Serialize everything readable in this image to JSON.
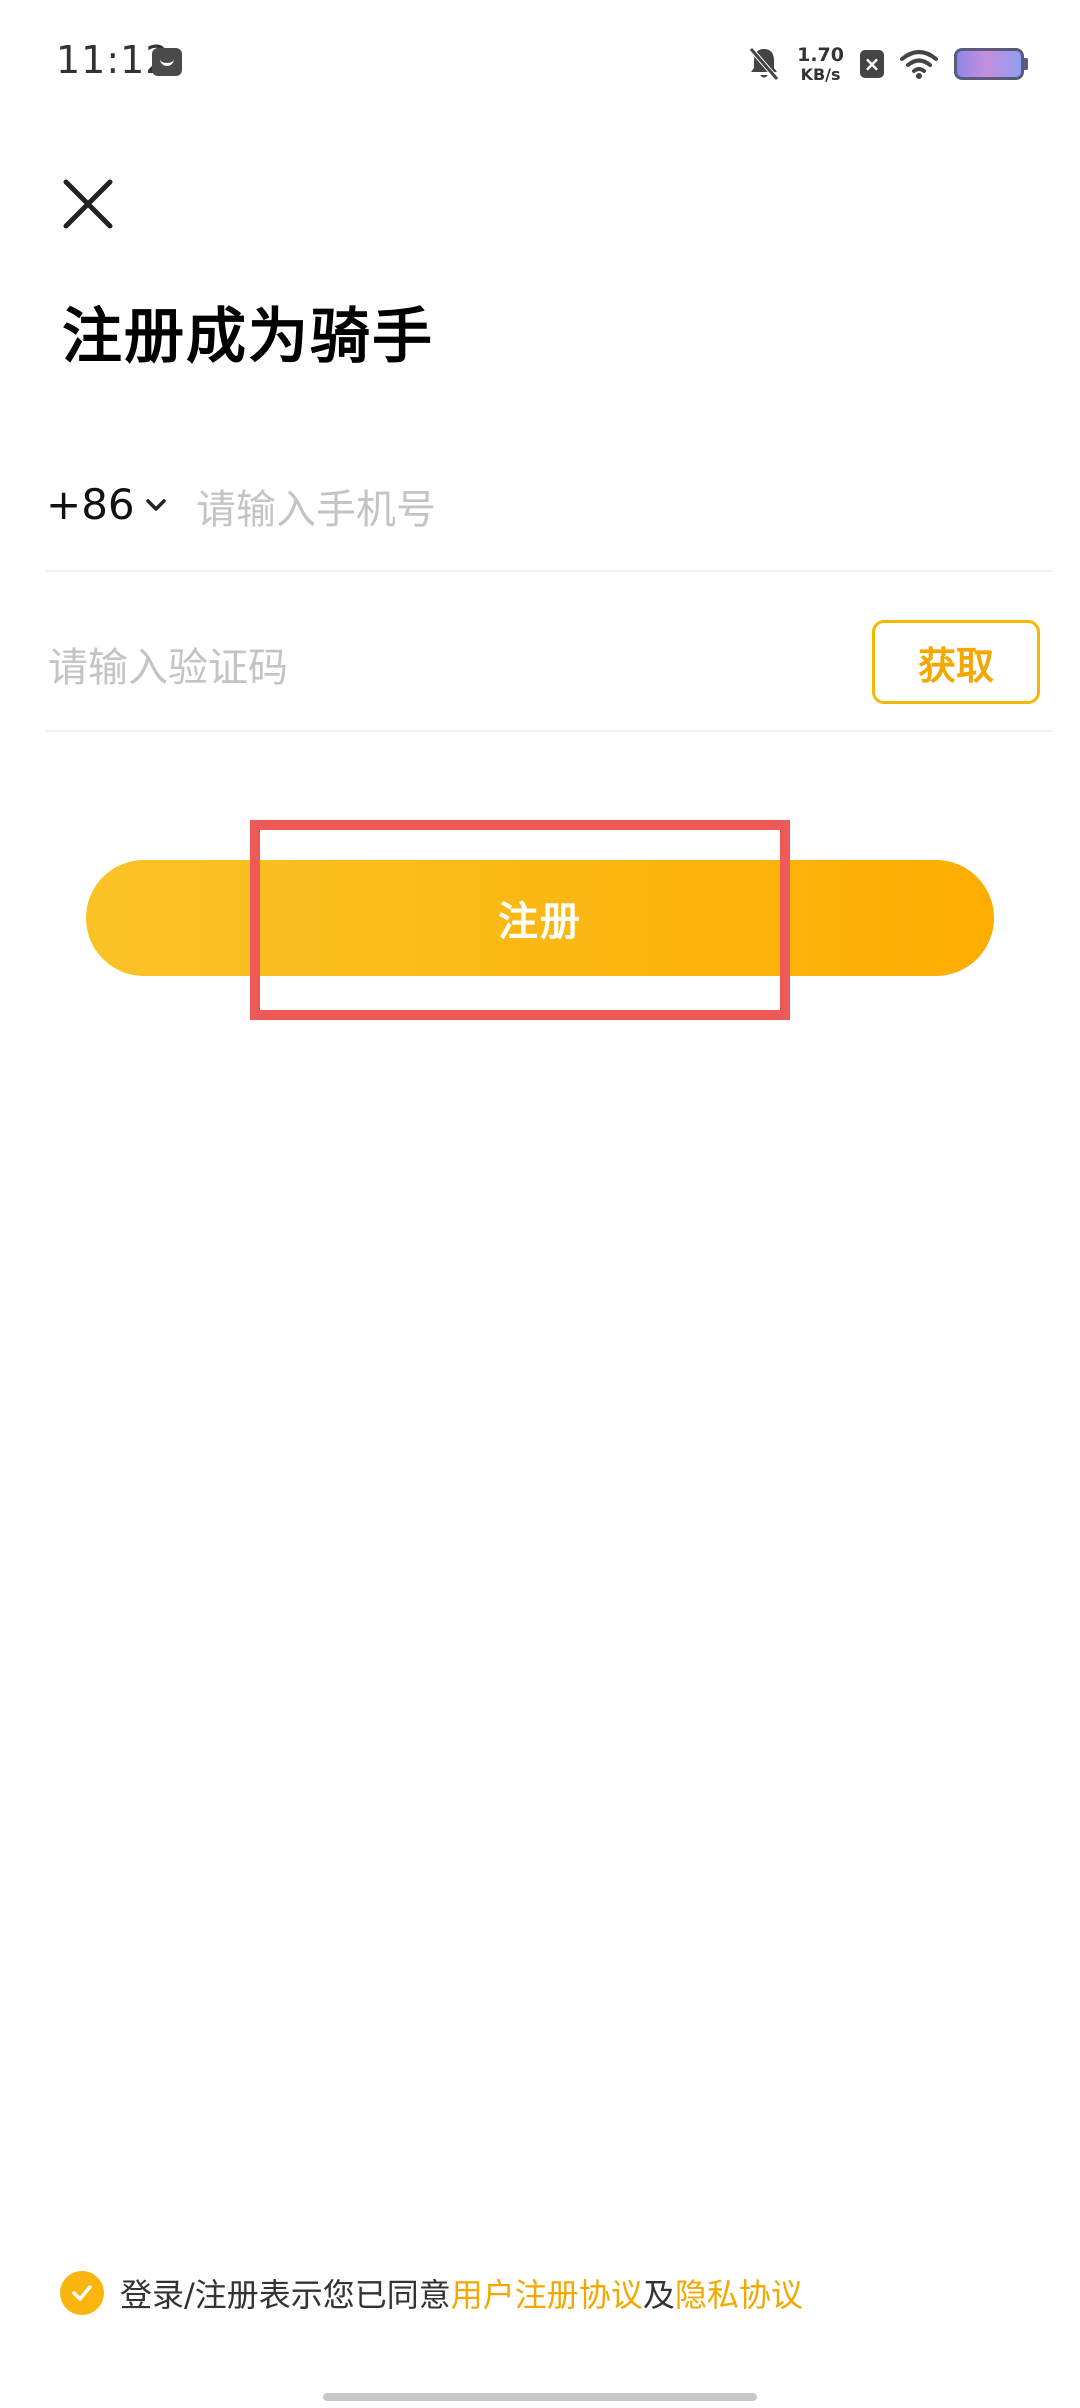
{
  "status_bar": {
    "time": "11:12",
    "net_speed_value": "1.70",
    "net_speed_unit": "KB/s",
    "x_badge": "×"
  },
  "header": {
    "title": "注册成为骑手"
  },
  "form": {
    "country_code": "+86",
    "phone_placeholder": "请输入手机号",
    "code_placeholder": "请输入验证码",
    "get_code_label": "获取",
    "register_label": "注册"
  },
  "agreement": {
    "checked": true,
    "prefix": "登录/注册表示您已同意",
    "user_agreement": "用户注册协议",
    "conjunction": "及",
    "privacy_policy": "隐私协议"
  },
  "colors": {
    "accent": "#fbb50f",
    "link": "#f3a800",
    "highlight_box": "#ee5a55"
  },
  "icons": {
    "close": "close-icon",
    "country_dropdown": "chevron-down-icon",
    "check": "check-icon"
  }
}
